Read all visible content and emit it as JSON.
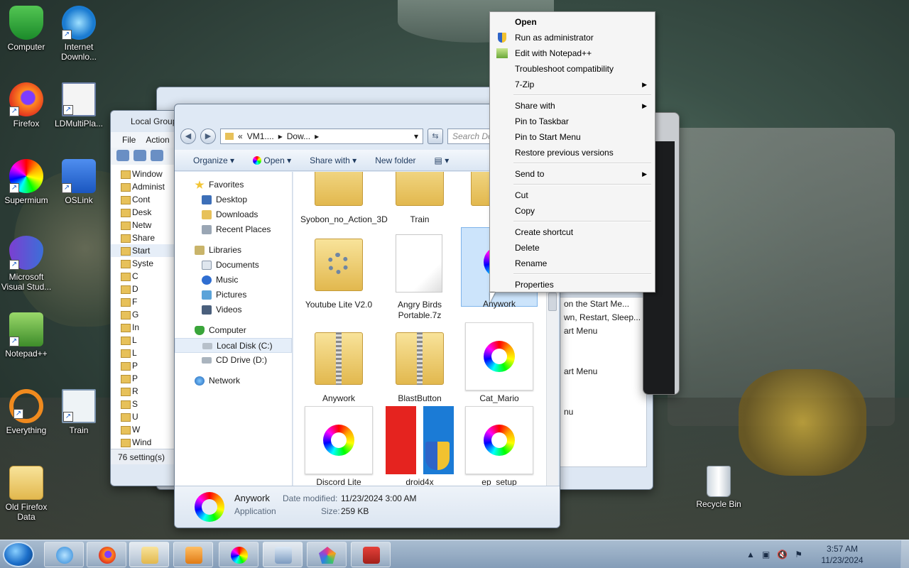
{
  "desktop": {
    "icons": [
      {
        "label": "Computer"
      },
      {
        "label": "Internet Downlo..."
      },
      {
        "label": "Firefox"
      },
      {
        "label": "LDMultiPla..."
      },
      {
        "label": "Supermium"
      },
      {
        "label": "OSLink"
      },
      {
        "label": "Microsoft Visual Stud..."
      },
      {
        "label": "Notepad++"
      },
      {
        "label": "Everything"
      },
      {
        "label": "Train"
      },
      {
        "label": "Old Firefox Data"
      },
      {
        "label": "Recycle Bin"
      }
    ]
  },
  "gp_window": {
    "title": "Local Group",
    "menu": [
      "File",
      "Action"
    ],
    "tree": [
      "Window",
      "Administ",
      "Cont",
      "Desk",
      "Netw",
      "Share",
      "Start",
      "Syste",
      "C",
      "D",
      "F",
      "G",
      "In",
      "L",
      "L",
      "P",
      "P",
      "R",
      "S",
      "U",
      "W",
      "Wind"
    ],
    "status": "76 setting(s)"
  },
  "bg_window": {
    "panel_lines": [
      "on the Start Me...",
      "wn, Restart, Sleep...",
      "art Menu",
      "",
      "",
      "art Menu",
      "",
      "",
      "nu"
    ]
  },
  "explorer": {
    "address": {
      "parts": [
        "«",
        "VM1....",
        "▸",
        "Dow...",
        "▸"
      ]
    },
    "search_placeholder": "Search Downloads",
    "cmdbar": {
      "organize": "Organize",
      "open": "Open",
      "share_with": "Share with",
      "new_folder": "New folder"
    },
    "nav": {
      "favorites": "Favorites",
      "desktop": "Desktop",
      "downloads": "Downloads",
      "recent": "Recent Places",
      "libraries": "Libraries",
      "documents": "Documents",
      "music": "Music",
      "pictures": "Pictures",
      "videos": "Videos",
      "computer": "Computer",
      "local_disk": "Local Disk (C:)",
      "cd_drive": "CD Drive (D:)",
      "network": "Network"
    },
    "files": [
      {
        "name": "Syobon_no_Action_3D"
      },
      {
        "name": "Train"
      },
      {
        "name": "Youtube Lite V2.0"
      },
      {
        "name": "Angry Birds Portable.7z"
      },
      {
        "name": "Anywork"
      },
      {
        "name": "Anywork"
      },
      {
        "name": "BlastButton"
      },
      {
        "name": "Cat_Mario"
      },
      {
        "name": "Discord Lite"
      },
      {
        "name": "droid4x"
      },
      {
        "name": "ep_setup"
      }
    ],
    "details": {
      "name": "Anywork",
      "type": "Application",
      "modified_label": "Date modified:",
      "modified_value": "11/23/2024 3:00 AM",
      "size_label": "Size:",
      "size_value": "259 KB"
    }
  },
  "context_menu": {
    "items": [
      {
        "label": "Open"
      },
      {
        "label": "Run as administrator"
      },
      {
        "label": "Edit with Notepad++"
      },
      {
        "label": "Troubleshoot compatibility"
      },
      {
        "label": "7-Zip"
      },
      {
        "label": "Share with"
      },
      {
        "label": "Pin to Taskbar"
      },
      {
        "label": "Pin to Start Menu"
      },
      {
        "label": "Restore previous versions"
      },
      {
        "label": "Send to"
      },
      {
        "label": "Cut"
      },
      {
        "label": "Copy"
      },
      {
        "label": "Create shortcut"
      },
      {
        "label": "Delete"
      },
      {
        "label": "Rename"
      },
      {
        "label": "Properties"
      }
    ]
  },
  "taskbar": {
    "clock_time": "3:57 AM",
    "clock_date": "11/23/2024"
  },
  "colors": {
    "accent": "#3a6ea5",
    "selection": "#cce4fb"
  }
}
